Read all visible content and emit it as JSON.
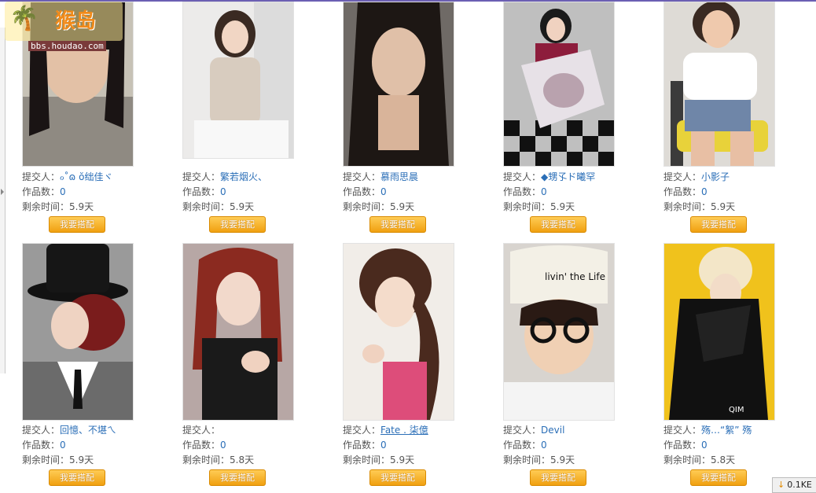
{
  "watermark": {
    "name": "猴岛",
    "url": "bbs.houdao.com"
  },
  "labels": {
    "submitter": "提交人：",
    "works": "作品数：",
    "remaining": "剩余时间："
  },
  "cards": [
    {
      "submitter": "ℴ˚ɷ ŏ绌佳ヾ",
      "works": "0",
      "time": "5.9天",
      "button": "我要搭配"
    },
    {
      "submitter": "繁若烟火、",
      "works": "0",
      "time": "5.9天",
      "button": "我要搭配"
    },
    {
      "submitter": "慕雨思晨",
      "works": "0",
      "time": "5.9天",
      "button": "我要搭配"
    },
    {
      "submitter": "◆甥孓ド曦罕",
      "works": "0",
      "time": "5.9天",
      "button": "我要搭配"
    },
    {
      "submitter": "小影子",
      "works": "0",
      "time": "5.9天",
      "button": "我要搭配"
    },
    {
      "submitter": "回憶、不堪ㄟ",
      "works": "0",
      "time": "5.9天",
      "button": "我要搭配"
    },
    {
      "submitter": "",
      "works": "0",
      "time": "5.8天",
      "button": "我要搭配"
    },
    {
      "submitter": "Fate .  柒億",
      "works": "0",
      "time": "5.9天",
      "button": "我要搭配"
    },
    {
      "submitter": "Devil",
      "works": "0",
      "time": "5.9天",
      "button": "我要搭配"
    },
    {
      "submitter": "殇…“絮” 殇",
      "works": "0",
      "time": "5.8天",
      "button": "我要搭配"
    }
  ],
  "photo_texts": {
    "cap_text": "livin' the Life",
    "logo_text": "QIM"
  },
  "download": {
    "arrow": "↓",
    "size": "0.1KE"
  },
  "colors": {
    "accent_link": "#2a6eb7",
    "button": "#f0a010",
    "top_border": "#6b5fb3"
  }
}
